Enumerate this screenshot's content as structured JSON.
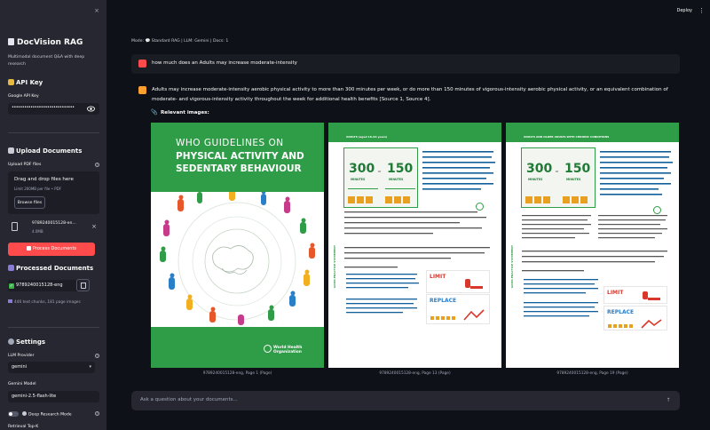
{
  "sidebar": {
    "close_glyph": "×",
    "app_title": "DocVision RAG",
    "app_subtitle": "Multimodal document Q&A with deep research",
    "api_key": {
      "heading": "API Key",
      "field_label": "Google API Key",
      "field_value": "••••••••••••••••••••••••••••••"
    },
    "upload": {
      "heading": "Upload Documents",
      "field_label": "Upload PDF files",
      "drop_title": "Drag and drop files here",
      "drop_limit": "Limit 200MB per file • PDF",
      "browse_label": "Browse files",
      "file_name": "9789240015128-en...",
      "file_size": "4.0MB",
      "process_button": "Process Documents"
    },
    "processed": {
      "heading": "Processed Documents",
      "item": "9789240015128-eng",
      "summary": "446 text chunks, 181 page images"
    },
    "settings": {
      "heading": "Settings",
      "llm_label": "LLM Provider",
      "llm_value": "gemini",
      "model_label": "Gemini Model",
      "model_value": "gemini-2.5-flash-lite",
      "deep_research_label": "Deep Research Mode",
      "retrieval_label": "Retrieval Top-K"
    }
  },
  "header": {
    "deploy_label": "Deploy",
    "menu_glyph": "⋮"
  },
  "chat": {
    "mode_line": "Mode: 💬 Standard RAG | LLM: Gemini | Docs: 1",
    "user_message": "how much does an Adults may increase moderate-intensity",
    "assistant_message": "Adults may increase moderate-intensity aerobic physical activity to more than 300 minutes per week, or do more than 150 minutes of vigorous-intensity aerobic physical activity, or an equivalent combination of moderate- and vigorous-intensity activity throughout the week for additional health benefits [Source 1, Source 4].",
    "relevant_images_label": "Relevant images:",
    "images": [
      {
        "caption": "9789240015128-eng, Page 1 (Page)"
      },
      {
        "caption": "9789240015128-eng, Page 13 (Page)"
      },
      {
        "caption": "9789240015128-eng, Page 19 (Page)"
      }
    ],
    "input_placeholder": "Ask a question about your documents...",
    "send_glyph": "↑"
  },
  "page1": {
    "title_line1": "WHO GUIDELINES ON",
    "title_line2": "PHYSICAL ACTIVITY AND SEDENTARY BEHAVIOUR",
    "org": "World Health Organization"
  },
  "page2": {
    "header": "ADULTS (aged 18–64 years)",
    "side": "GOOD PRACTICE STATEMENT",
    "big1": "300",
    "big1_sub": "MINUTES",
    "or": "or",
    "big2": "150",
    "big2_sub": "MINUTES",
    "limit": "LIMIT",
    "replace": "REPLACE"
  },
  "page3": {
    "header": "ADULTS AND OLDER ADULTS WITH CHRONIC CONDITIONS",
    "side": "GOOD PRACTICE STATEMENT",
    "big1": "300",
    "big1_sub": "MINUTES",
    "or": "or",
    "big2": "150",
    "big2_sub": "MINUTES",
    "limit": "LIMIT",
    "replace": "REPLACE"
  },
  "colors": {
    "accent_red": "#ff4b4b",
    "who_green": "#2f9c47",
    "background": "#0e1117",
    "sidebar": "#262730"
  }
}
